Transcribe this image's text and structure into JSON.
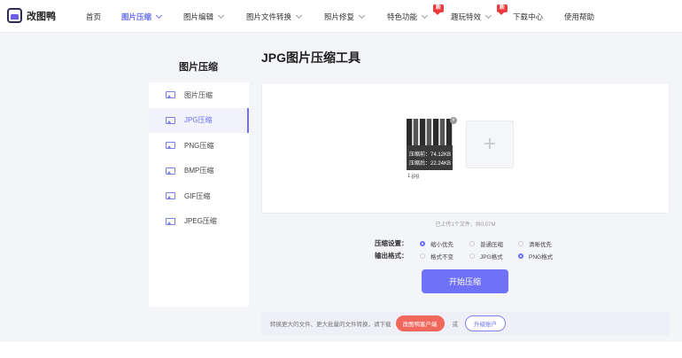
{
  "header": {
    "logo_text": "改图鸭",
    "nav": [
      {
        "label": "首页"
      },
      {
        "label": "图片压缩"
      },
      {
        "label": "图片编辑"
      },
      {
        "label": "图片文件转换"
      },
      {
        "label": "照片修复"
      },
      {
        "label": "特色功能",
        "badge": "新"
      },
      {
        "label": "趣玩特效",
        "badge": "新"
      },
      {
        "label": "下载中心"
      },
      {
        "label": "使用帮助"
      }
    ]
  },
  "sidebar": {
    "title": "图片压缩",
    "items": [
      {
        "label": "图片压缩"
      },
      {
        "label": "JPG压缩"
      },
      {
        "label": "PNG压缩"
      },
      {
        "label": "BMP压缩"
      },
      {
        "label": "GIF压缩"
      },
      {
        "label": "JPEG压缩"
      }
    ]
  },
  "main": {
    "title": "JPG图片压缩工具",
    "thumb": {
      "before": "压缩前：74.12KB",
      "after": "压缩后：22.24KB",
      "filename": "1.jpg",
      "close": "×"
    },
    "add_symbol": "+",
    "upload_status": "已上传1个文件，共0.07M",
    "compress_label": "压缩设置：",
    "compress_options": [
      "缩小优先",
      "普通压缩",
      "清晰优先"
    ],
    "compress_selected": 0,
    "format_label": "输出格式：",
    "format_options": [
      "格式不变",
      "JPG格式",
      "PNG格式"
    ],
    "format_selected": 2,
    "start_button": "开始压缩"
  },
  "bottom": {
    "text": "转换更大的文件、更大批量的文件转换，请下载",
    "client_button": "改图鸭客户端",
    "or": "或",
    "upgrade_button": "升级账户"
  },
  "colors": {
    "accent": "#6b70f5",
    "badge": "#ee3b3b",
    "client_button": "#f2675c"
  }
}
